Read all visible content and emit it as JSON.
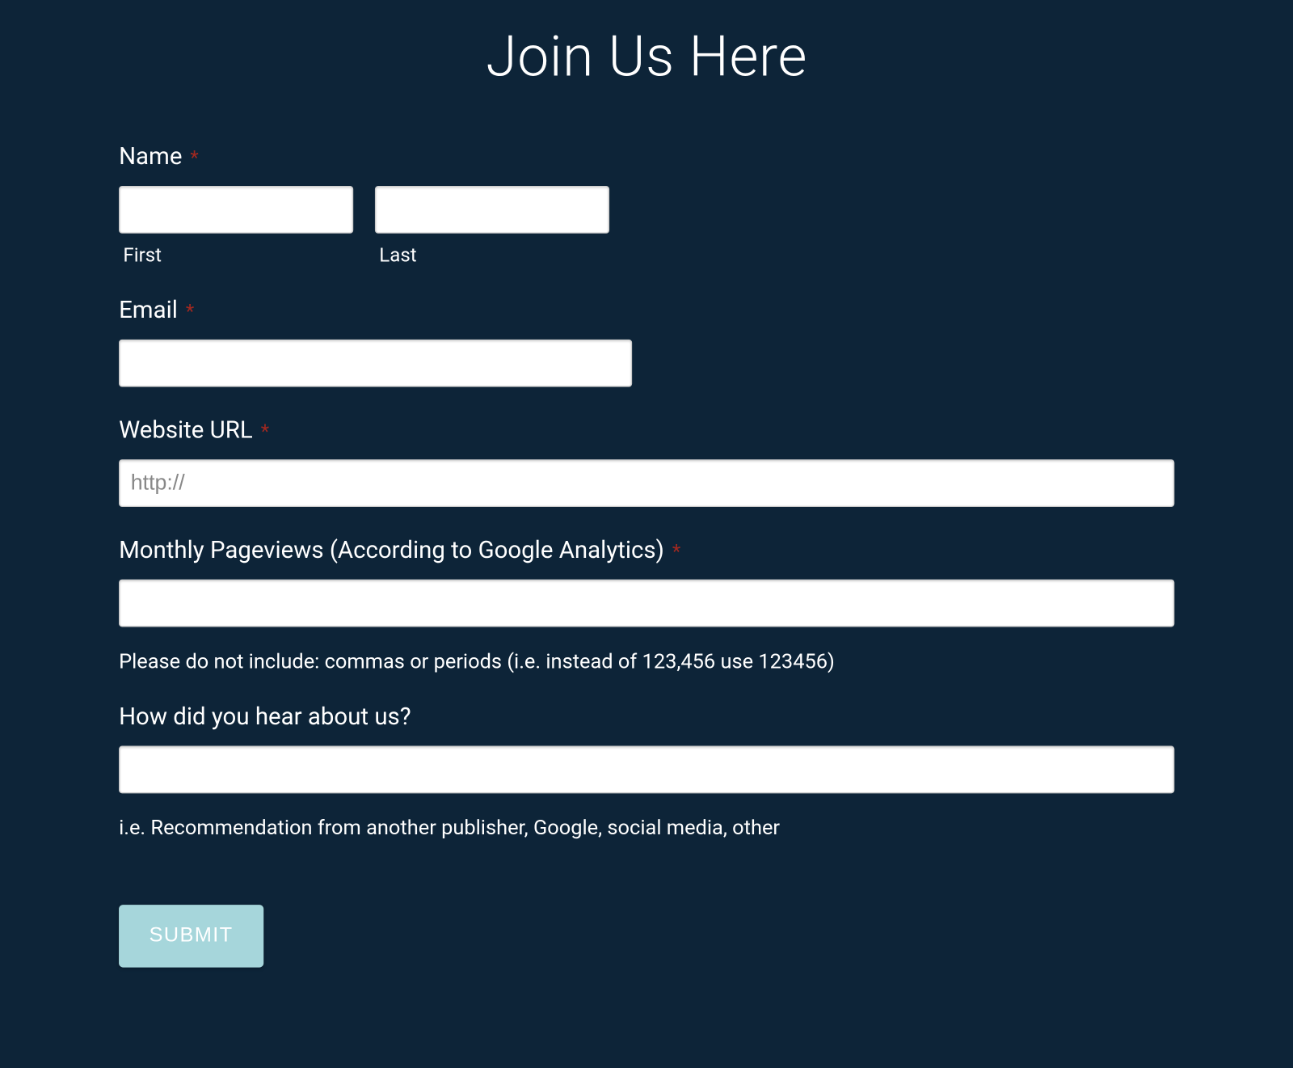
{
  "title": "Join Us Here",
  "fields": {
    "name": {
      "label": "Name",
      "required": "*",
      "first_sublabel": "First",
      "last_sublabel": "Last"
    },
    "email": {
      "label": "Email",
      "required": "*"
    },
    "website": {
      "label": "Website URL",
      "required": "*",
      "placeholder": "http://"
    },
    "pageviews": {
      "label": "Monthly Pageviews (According to Google Analytics)",
      "required": "*",
      "help": "Please do not include: commas or periods (i.e. instead of 123,456 use 123456)"
    },
    "hear": {
      "label": "How did you hear about us?",
      "help": "i.e. Recommendation from another publisher, Google, social media, other"
    }
  },
  "submit_label": "SUBMIT"
}
